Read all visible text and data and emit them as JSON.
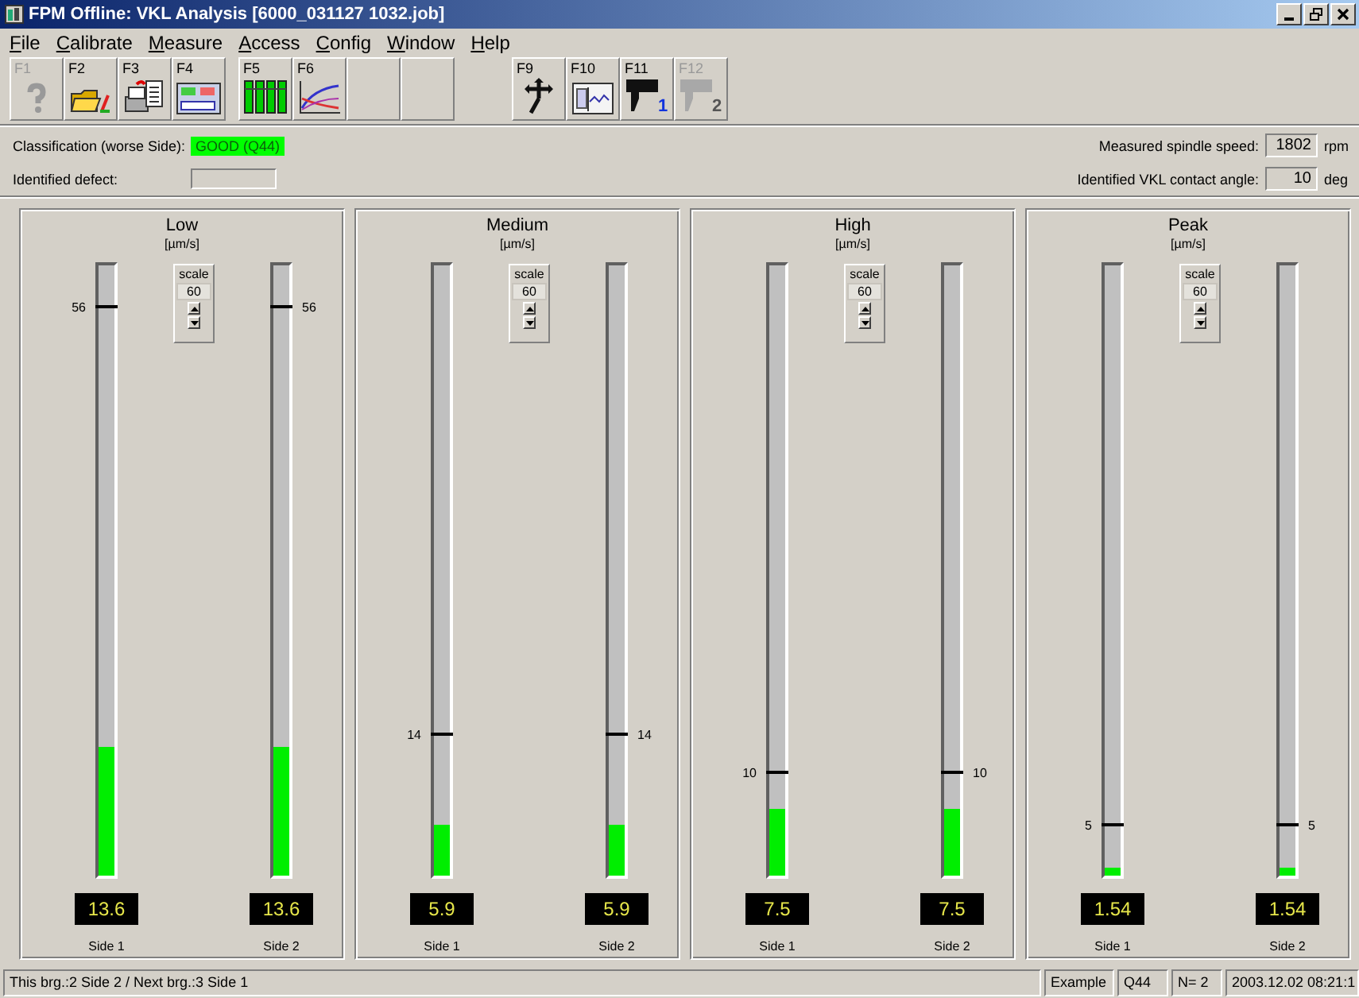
{
  "window": {
    "title": "FPM Offline: VKL Analysis  [6000_031127 1032.job]"
  },
  "menu": [
    {
      "label": "File"
    },
    {
      "label": "Calibrate"
    },
    {
      "label": "Measure"
    },
    {
      "label": "Access"
    },
    {
      "label": "Config"
    },
    {
      "label": "Window"
    },
    {
      "label": "Help"
    }
  ],
  "toolbar": [
    {
      "key": "F1",
      "kind": "help",
      "disabled": true
    },
    {
      "key": "F2",
      "kind": "open",
      "disabled": false
    },
    {
      "key": "F3",
      "kind": "print",
      "disabled": false
    },
    {
      "key": "F4",
      "kind": "form",
      "disabled": false
    },
    {
      "key": "F5",
      "kind": "bars",
      "disabled": false
    },
    {
      "key": "F6",
      "kind": "chart",
      "disabled": false
    },
    {
      "kind": "blank"
    },
    {
      "kind": "blank"
    },
    {
      "key": "F9",
      "kind": "move",
      "disabled": false
    },
    {
      "key": "F10",
      "kind": "scope",
      "disabled": false
    },
    {
      "key": "F11",
      "kind": "sensor",
      "badge": "1",
      "disabled": false
    },
    {
      "key": "F12",
      "kind": "sensor",
      "badge": "2",
      "disabled": true
    }
  ],
  "classification": {
    "label": "Classification (worse Side):",
    "value": "GOOD (Q44)",
    "kind": "good"
  },
  "defect": {
    "label": "Identified defect:"
  },
  "spindle_speed": {
    "label": "Measured spindle speed:",
    "value": "1802",
    "unit": "rpm"
  },
  "contact_angle": {
    "label": "Identified VKL contact angle:",
    "value": "10",
    "unit": "deg"
  },
  "panels": [
    {
      "title": "Low",
      "unit": "[µm/s]",
      "scale_label": "scale",
      "scale": "60",
      "sides": [
        {
          "label": "Side 1",
          "reading": "13.6",
          "level": 0.212,
          "threshold": {
            "label": "56",
            "level": 0.932
          }
        },
        {
          "label": "Side 2",
          "reading": "13.6",
          "level": 0.212,
          "threshold": {
            "label": "56",
            "level": 0.932
          }
        }
      ]
    },
    {
      "title": "Medium",
      "unit": "[µm/s]",
      "scale_label": "scale",
      "scale": "60",
      "sides": [
        {
          "label": "Side 1",
          "reading": "5.9",
          "level": 0.083,
          "threshold": {
            "label": "14",
            "level": 0.232
          }
        },
        {
          "label": "Side 2",
          "reading": "5.9",
          "level": 0.083,
          "threshold": {
            "label": "14",
            "level": 0.232
          }
        }
      ]
    },
    {
      "title": "High",
      "unit": "[µm/s]",
      "scale_label": "scale",
      "scale": "60",
      "sides": [
        {
          "label": "Side 1",
          "reading": "7.5",
          "level": 0.11,
          "threshold": {
            "label": "10",
            "level": 0.169
          }
        },
        {
          "label": "Side 2",
          "reading": "7.5",
          "level": 0.11,
          "threshold": {
            "label": "10",
            "level": 0.169
          }
        }
      ]
    },
    {
      "title": "Peak",
      "unit": "[µm/s]",
      "scale_label": "scale",
      "scale": "60",
      "sides": [
        {
          "label": "Side 1",
          "reading": "1.54",
          "level": 0.013,
          "threshold": {
            "label": "5",
            "level": 0.083
          }
        },
        {
          "label": "Side 2",
          "reading": "1.54",
          "level": 0.013,
          "threshold": {
            "label": "5",
            "level": 0.083
          }
        }
      ]
    }
  ],
  "status_bar": [
    {
      "text": "This brg.:2 Side 2 / Next brg.:3 Side 1",
      "kind": "wide"
    },
    {
      "text": "Example",
      "kind": "normal"
    },
    {
      "text": "Q44",
      "kind": "normal"
    },
    {
      "text": "N= 2",
      "kind": "normal"
    },
    {
      "text": "2003.12.02 08:21:1",
      "kind": "time"
    }
  ]
}
